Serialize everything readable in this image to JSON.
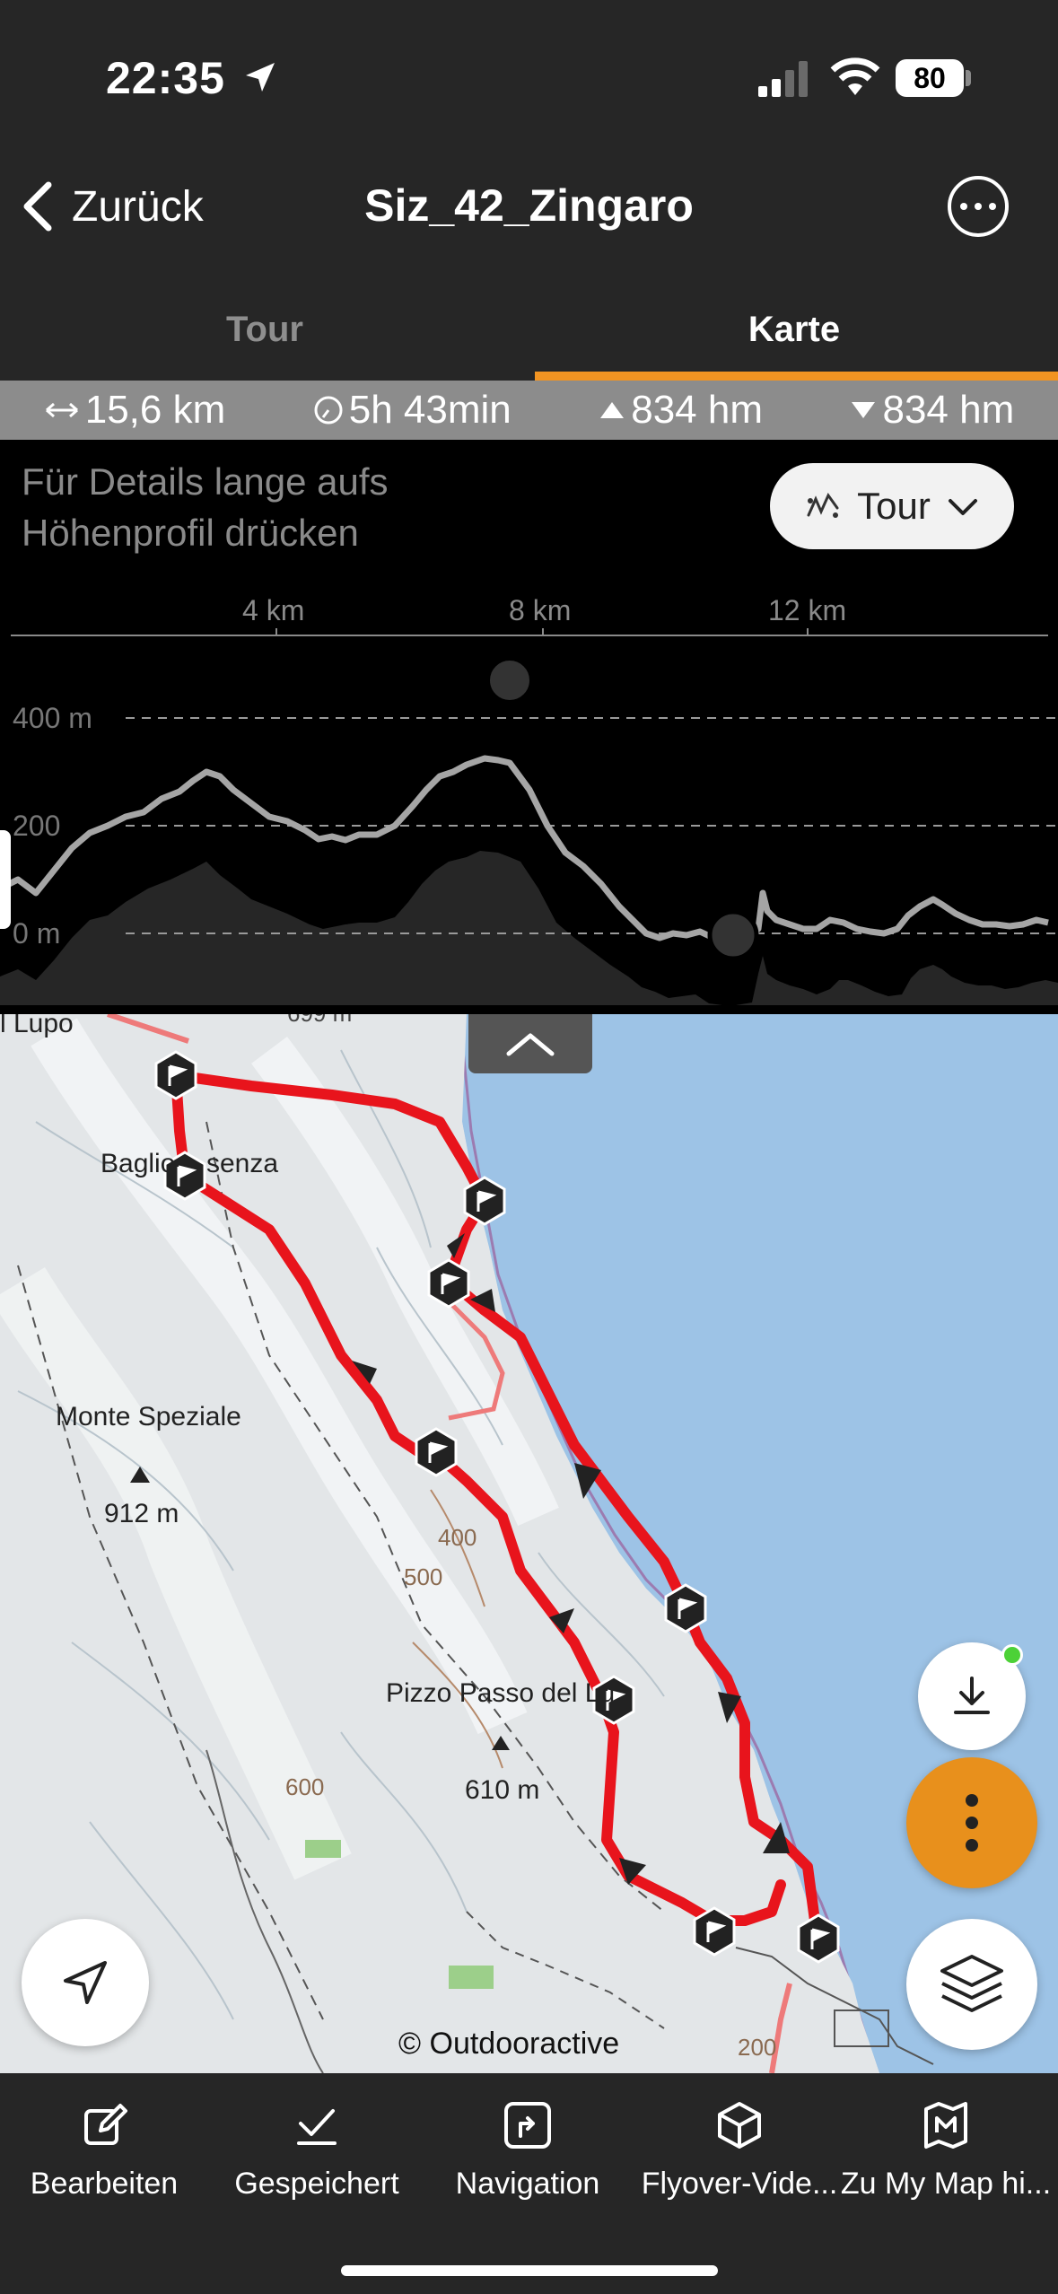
{
  "status_bar": {
    "time": "22:35",
    "battery": "80"
  },
  "header": {
    "back_label": "Zurück",
    "title": "Siz_42_Zingaro"
  },
  "tabs": [
    {
      "label": "Tour",
      "active": false
    },
    {
      "label": "Karte",
      "active": true
    }
  ],
  "stats": {
    "distance": "15,6 km",
    "duration": "5h 43min",
    "ascent": "834 hm",
    "descent": "834 hm"
  },
  "profile": {
    "hint": "Für Details lange aufs Höhenprofil drücken",
    "filter_label": "Tour",
    "x_ticks": [
      "4 km",
      "8 km",
      "12 km"
    ],
    "y_ticks": [
      "400 m",
      "200",
      "0 m"
    ]
  },
  "map": {
    "labels": {
      "lupo": "l Lupo",
      "peak_top": "699 m",
      "baglio": "Baglio",
      "senza": "senza",
      "monte": "Monte Speziale",
      "monte_elev": "912 m",
      "pizzo": "Pizzo Passo del Lu",
      "pizzo_elev": "610 m",
      "c400": "400",
      "c500": "500",
      "c600": "600",
      "c200": "200"
    },
    "attribution": "© Outdooractive"
  },
  "actions": [
    {
      "label": "Bearbeiten",
      "icon": "edit-icon"
    },
    {
      "label": "Gespeichert",
      "icon": "saved-check-icon"
    },
    {
      "label": "Navigation",
      "icon": "navigation-icon"
    },
    {
      "label": "Flyover-Vide...",
      "icon": "flyover-cube-icon"
    },
    {
      "label": "Zu My Map hi...",
      "icon": "my-map-icon"
    }
  ],
  "colors": {
    "accent": "#f29422",
    "route": "#e8141c",
    "sea": "#9dc3e6",
    "options_button": "#e8901c"
  }
}
